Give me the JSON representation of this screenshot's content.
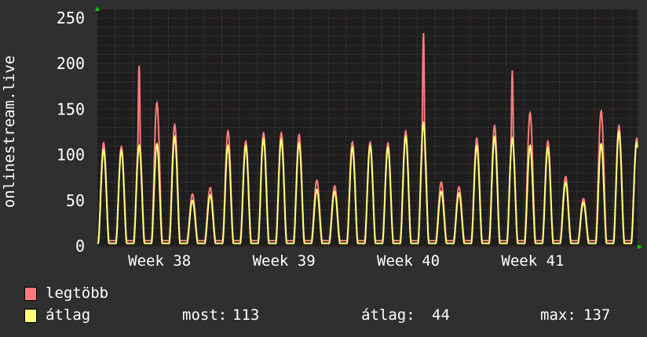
{
  "chart_data": {
    "type": "line",
    "ylabel": "onlinestream.live",
    "ylim": [
      0,
      250
    ],
    "yticks": [
      0,
      50,
      100,
      150,
      200,
      250
    ],
    "x_unit": "days",
    "xlim": [
      0,
      30.4
    ],
    "week_labels": [
      {
        "label": "Week 38",
        "start_day": 0
      },
      {
        "label": "Week 39",
        "start_day": 7
      },
      {
        "label": "Week 40",
        "start_day": 14
      },
      {
        "label": "Week 41",
        "start_day": 21
      }
    ],
    "series": [
      {
        "name": "legtöbb",
        "color": "#ff7b7b",
        "daily_peaks": [
          113,
          109,
          198,
          157,
          133,
          57,
          64,
          126,
          115,
          124,
          124,
          122,
          72,
          66,
          114,
          114,
          113,
          126,
          234,
          70,
          65,
          118,
          132,
          193,
          146,
          115,
          76,
          52,
          148,
          132,
          118
        ],
        "daily_trough": 6
      },
      {
        "name": "átlag",
        "color": "#ffff7b",
        "daily_peaks": [
          106,
          105,
          110,
          112,
          120,
          50,
          56,
          110,
          110,
          118,
          117,
          113,
          62,
          60,
          108,
          110,
          108,
          120,
          135,
          60,
          58,
          110,
          120,
          118,
          110,
          108,
          70,
          48,
          112,
          125,
          113
        ],
        "daily_trough": 3
      }
    ],
    "stats": {
      "now_label": "most:",
      "now": "113",
      "avg_label": "átlag:",
      "avg": "44",
      "max_label": "max:",
      "max": "137"
    }
  }
}
